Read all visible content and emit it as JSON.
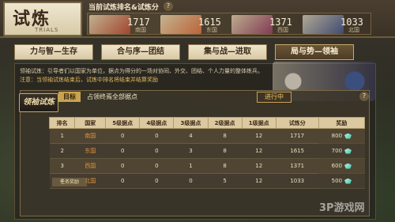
{
  "header": {
    "title": "试炼",
    "title_sub": "TRIALS",
    "rank_title": "当前试炼排名&试炼分",
    "help": "?"
  },
  "nations": [
    {
      "name": "南国",
      "score": "1717",
      "color": "#b0452e"
    },
    {
      "name": "东国",
      "score": "1615",
      "color": "#cf6a3a"
    },
    {
      "name": "西国",
      "score": "1371",
      "color": "#8d3a5a"
    },
    {
      "name": "北国",
      "score": "1033",
      "color": "#3f4f7e"
    }
  ],
  "tabs": [
    {
      "label": "力与智—生存",
      "active": false
    },
    {
      "label": "合与序—团结",
      "active": false
    },
    {
      "label": "集与战—进取",
      "active": false
    },
    {
      "label": "局与势—领袖",
      "active": true
    }
  ],
  "description": {
    "line1": "领袖试炼：引导者们以国家为单位，据点为得分的一场对协同、外交、团结、个人力量的整体练兵。",
    "line2": "注意：当领袖试炼结束后，试炼中排名将结束并结算奖励"
  },
  "badge": "领袖试炼",
  "goal": {
    "label": "目标",
    "text": "占领终焉全部据点",
    "status": "进行中",
    "help": "?"
  },
  "table": {
    "headers": [
      "排名",
      "国家",
      "5级据点",
      "4级据点",
      "3级据点",
      "2级据点",
      "1级据点",
      "试炼分",
      "奖励"
    ],
    "rows": [
      {
        "rank": "1",
        "nation": "南国",
        "l5": "0",
        "l4": "0",
        "l3": "4",
        "l2": "8",
        "l1": "12",
        "score": "1717",
        "reward": "800"
      },
      {
        "rank": "2",
        "nation": "东国",
        "l5": "0",
        "l4": "0",
        "l3": "3",
        "l2": "8",
        "l1": "12",
        "score": "1615",
        "reward": "700"
      },
      {
        "rank": "3",
        "nation": "西国",
        "l5": "0",
        "l4": "0",
        "l3": "1",
        "l2": "8",
        "l1": "12",
        "score": "1371",
        "reward": "600"
      },
      {
        "rank": "4",
        "nation": "北国",
        "l5": "0",
        "l4": "0",
        "l3": "0",
        "l2": "5",
        "l1": "12",
        "score": "1033",
        "reward": "500"
      }
    ]
  },
  "mission_tag": "任务奖励",
  "watermark": "3P游戏网"
}
